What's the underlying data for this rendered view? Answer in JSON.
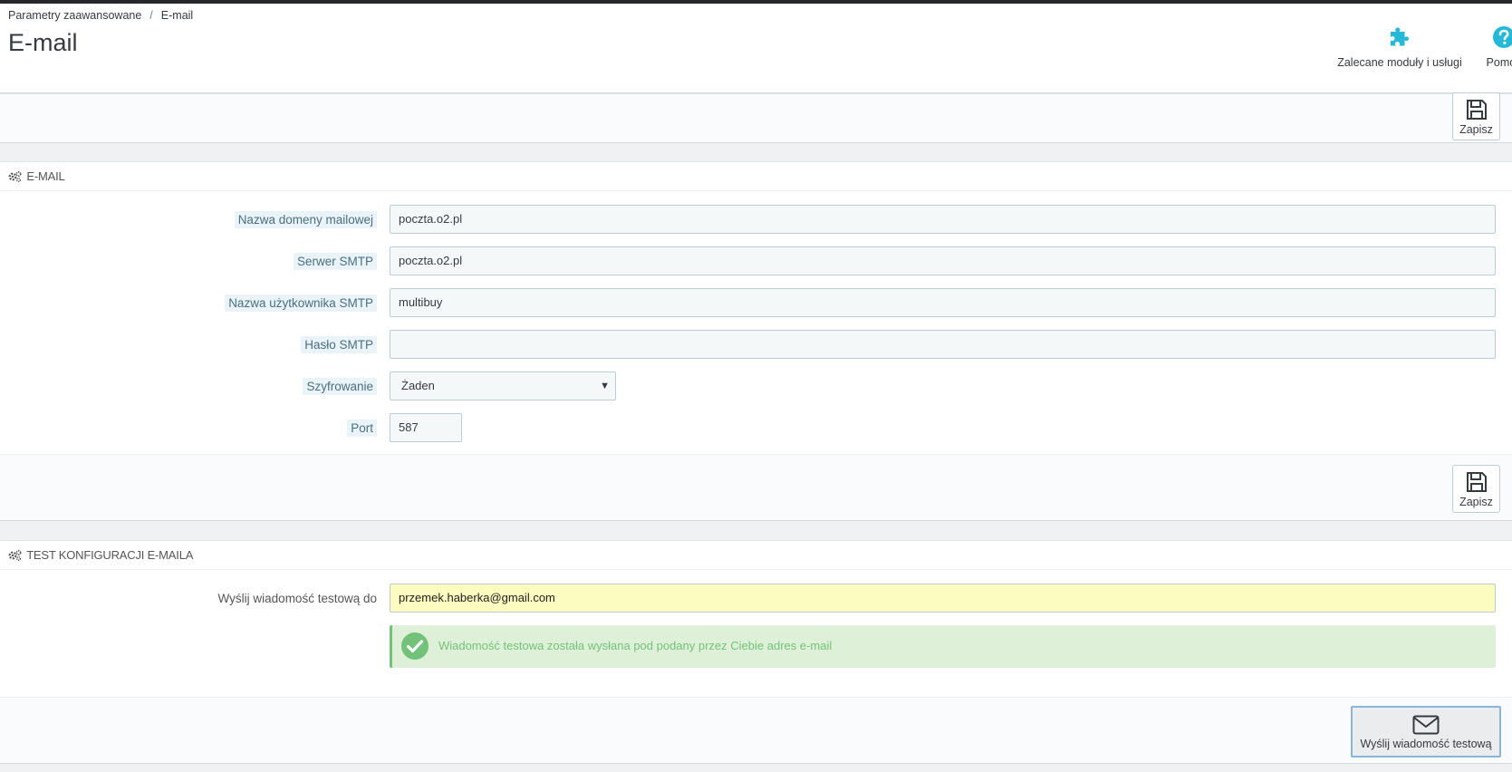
{
  "breadcrumb": {
    "parent": "Parametry zaawansowane",
    "separator": "/",
    "current": "E-mail"
  },
  "page_title": "E-mail",
  "toolbar": {
    "modules_label": "Zalecane moduły i usługi",
    "modules_icon": "puzzle-icon",
    "help_label": "Pomoc",
    "help_icon": "question-circle-icon",
    "accent_color": "#25b9d7"
  },
  "top_bar": {
    "save_label": "Zapisz"
  },
  "email_panel": {
    "heading": "E-MAIL",
    "heading_icon": "gears-icon",
    "fields": {
      "domain": {
        "label": "Nazwa domeny mailowej",
        "value": "poczta.o2.pl"
      },
      "smtp_server": {
        "label": "Serwer SMTP",
        "value": "poczta.o2.pl"
      },
      "smtp_user": {
        "label": "Nazwa użytkownika SMTP",
        "value": "multibuy"
      },
      "smtp_password": {
        "label": "Hasło SMTP",
        "value": ""
      },
      "encryption": {
        "label": "Szyfrowanie",
        "value": "Żaden"
      },
      "port": {
        "label": "Port",
        "value": "587"
      }
    },
    "save_label": "Zapisz"
  },
  "test_panel": {
    "heading": "TEST KONFIGURACJI E-MAILA",
    "heading_icon": "gears-icon",
    "send_to_label": "Wyślij wiadomość testową do",
    "send_to_value": "przemek.haberka@gmail.com",
    "success_message": "Wiadomość testowa została wysłana pod podany przez Ciebie adres e-mail",
    "success_color": "#72c279",
    "send_button_label": "Wyślij wiadomość testową",
    "send_button_icon": "envelope-icon"
  }
}
